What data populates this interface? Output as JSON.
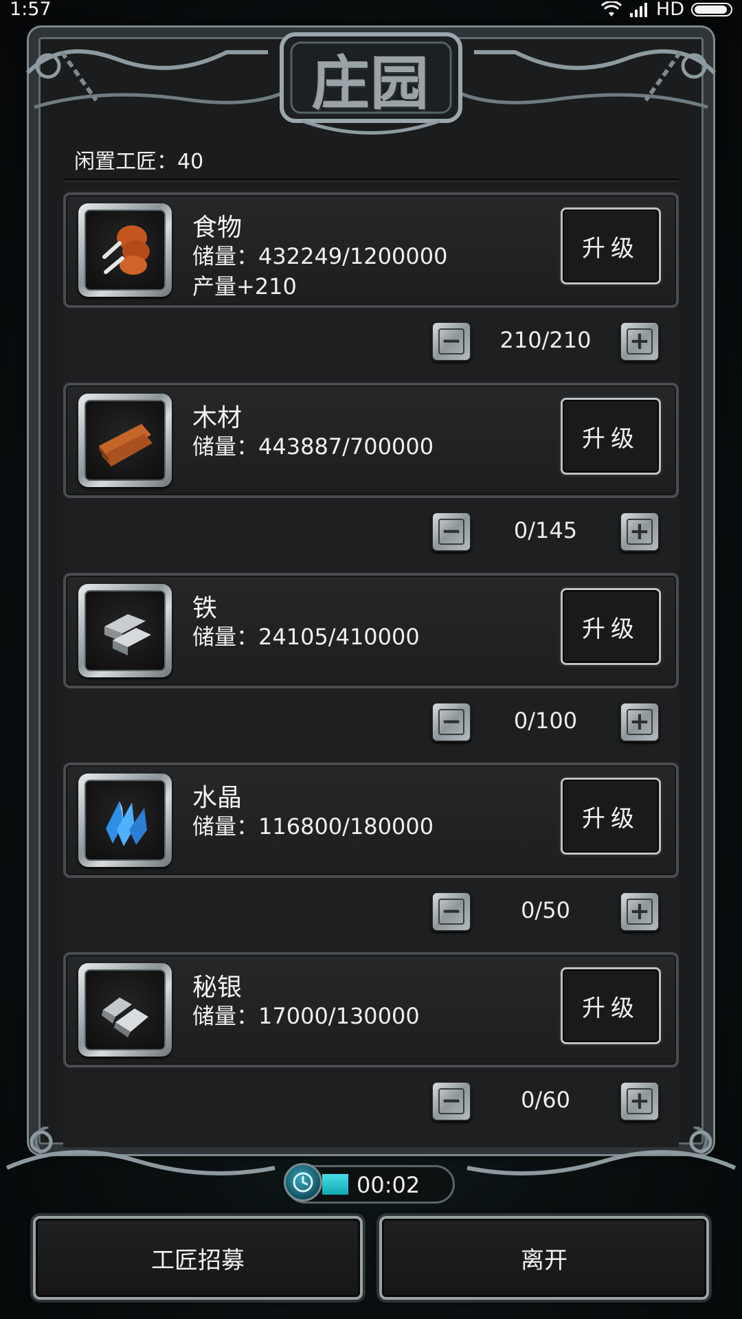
{
  "status_bar": {
    "time": "1:57",
    "network": "HD"
  },
  "window": {
    "title": "庄园"
  },
  "idle": {
    "label": "闲置工匠：40"
  },
  "resources": [
    {
      "name": "食物",
      "icon": "drumstick-icon",
      "stock": "储量：432249/1200000",
      "output": "产量+210",
      "upgrade_label": "升级",
      "assigned": "210/210"
    },
    {
      "name": "木材",
      "icon": "wood-planks-icon",
      "stock": "储量：443887/700000",
      "output": "",
      "upgrade_label": "升级",
      "assigned": "0/145"
    },
    {
      "name": "铁",
      "icon": "iron-ingot-icon",
      "stock": "储量：24105/410000",
      "output": "",
      "upgrade_label": "升级",
      "assigned": "0/100"
    },
    {
      "name": "水晶",
      "icon": "crystal-icon",
      "stock": "储量：116800/180000",
      "output": "",
      "upgrade_label": "升级",
      "assigned": "0/50"
    },
    {
      "name": "秘银",
      "icon": "mithril-ore-icon",
      "stock": "储量：17000/130000",
      "output": "",
      "upgrade_label": "升级",
      "assigned": "0/60"
    }
  ],
  "timer": {
    "text": "00:02"
  },
  "buttons": {
    "recruit": "工匠招募",
    "leave": "离开"
  }
}
